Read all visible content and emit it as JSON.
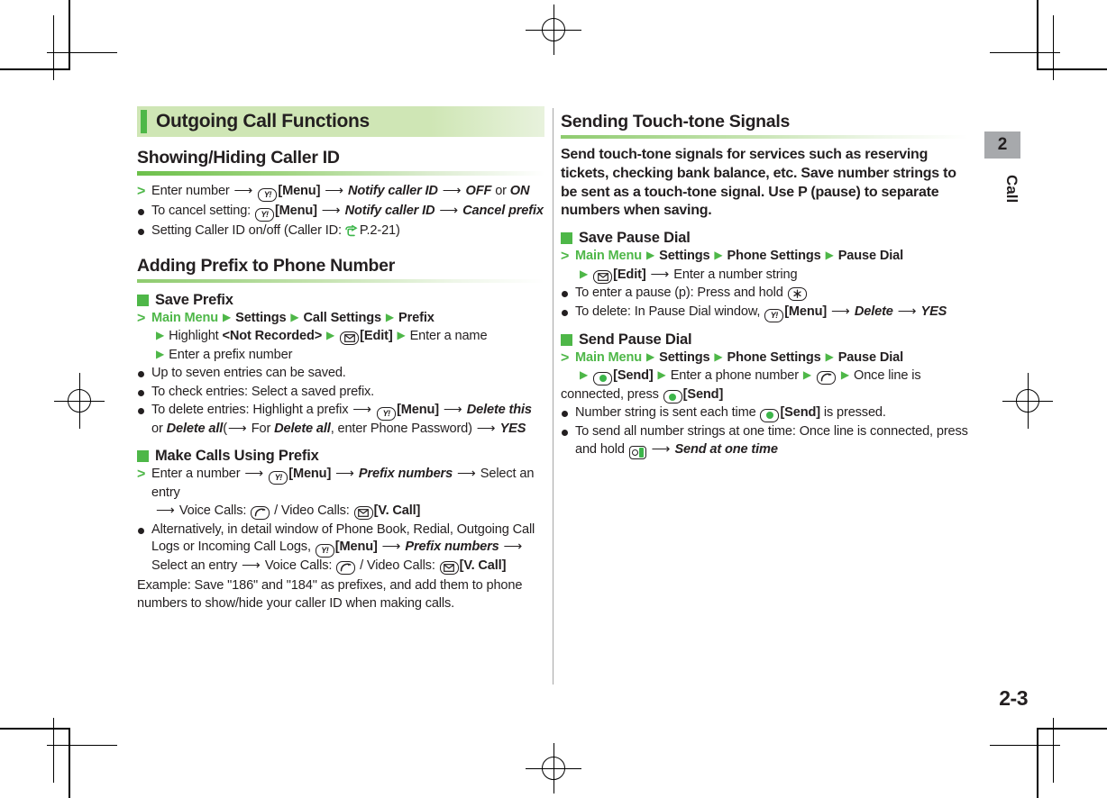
{
  "page": {
    "number": "2-3",
    "chapter_number": "2",
    "chapter_label": "Call"
  },
  "left_column": {
    "section_banner": "Outgoing Call Functions",
    "subsections": [
      {
        "title": "Showing/Hiding Caller ID",
        "lines": [
          "Enter number → [Y!][Menu] → Notify caller ID → OFF or ON",
          "To cancel setting: [Y!][Menu] → Notify caller ID → Cancel prefix",
          "Setting Caller ID on/off (Caller ID: ☞ P.2-21)"
        ]
      },
      {
        "title": "Adding Prefix to Phone Number",
        "groups": [
          {
            "heading": "Save Prefix",
            "lines": [
              "Main Menu ▶ Settings ▶ Call Settings ▶ Prefix",
              "▶ Highlight <Not Recorded> ▶ [Mail][Edit] ▶ Enter a name",
              "▶ Enter a prefix number",
              "Up to seven entries can be saved.",
              "To check entries: Select a saved prefix.",
              "To delete entries: Highlight a prefix → [Y!][Menu] → Delete this or Delete all (→ For Delete all, enter Phone Password) → YES"
            ]
          },
          {
            "heading": "Make Calls Using Prefix",
            "lines": [
              "Enter a number → [Y!][Menu] → Prefix numbers → Select an entry → Voice Calls: [Call] / Video Calls: [Mail][V. Call]",
              "Alternatively, in detail window of Phone Book, Redial, Outgoing Call Logs or Incoming Call Logs, [Y!][Menu] → Prefix numbers → Select an entry → Voice Calls: [Call] / Video Calls: [Mail][V. Call]"
            ]
          }
        ],
        "example": "Example: Save \"186\" and \"184\" as prefixes, and add them to phone numbers to show/hide your caller ID when making calls."
      }
    ],
    "text": {
      "caller_id_step_1a": "Enter number",
      "caller_id_step_1b": "[Menu]",
      "caller_id_step_1c": "Notify caller ID",
      "caller_id_step_1d": "OFF",
      "caller_id_step_1e": "or",
      "caller_id_step_1f": "ON",
      "caller_id_b1a": "To cancel setting:",
      "caller_id_b1b": "[Menu]",
      "caller_id_b1c": "Notify caller ID",
      "caller_id_b1d": "Cancel prefix",
      "caller_id_b2a": "Setting Caller ID on/off (Caller ID:",
      "caller_id_b2b": "P.2-21)",
      "save_prefix_heading": "Save Prefix",
      "sp_step_main": "Main Menu",
      "sp_step_settings": "Settings",
      "sp_step_call_settings": "Call Settings",
      "sp_step_prefix": "Prefix",
      "sp_l2_highlight": "Highlight",
      "sp_l2_notrec": "<Not Recorded>",
      "sp_l2_edit": "[Edit]",
      "sp_l2_entername": "Enter a name",
      "sp_l3": "Enter a prefix number",
      "sp_b1": "Up to seven entries can be saved.",
      "sp_b2": "To check entries: Select a saved prefix.",
      "sp_b3a": "To delete entries: Highlight a prefix",
      "sp_b3b": "[Menu]",
      "sp_b3c": "Delete this",
      "sp_b3d": "or",
      "sp_b3e": "Delete all",
      "sp_b3f": "For",
      "sp_b3g": "Delete all",
      "sp_b3h": ", enter Phone Password)",
      "sp_b3i": "YES",
      "mcup_heading": "Make Calls Using Prefix",
      "mcup_s1a": "Enter a number",
      "mcup_s1b": "[Menu]",
      "mcup_s1c": "Prefix numbers",
      "mcup_s1d": "Select an entry",
      "mcup_s2a": "Voice Calls:",
      "mcup_s2b": "/ Video Calls:",
      "mcup_s2c": "[V. Call]",
      "mcup_b1a": "Alternatively, in detail window of Phone Book, Redial, Outgoing Call Logs or Incoming Call Logs,",
      "mcup_b1b": "[Menu]",
      "mcup_b1c": "Prefix numbers",
      "mcup_b1d": "Select an",
      "mcup_b1e": "entry",
      "mcup_b1f": "Voice Calls:",
      "mcup_b1g": "/ Video Calls:",
      "mcup_b1h": "[V. Call]",
      "example_text": "Example: Save \"186\" and \"184\" as prefixes, and add them to phone numbers to show/hide your caller ID when making calls."
    }
  },
  "right_column": {
    "title": "Sending Touch-tone Signals",
    "lead": "Send touch-tone signals for services such as reserving tickets, checking bank balance, etc. Save number strings to be sent as a touch-tone signal. Use P (pause) to separate numbers when saving.",
    "text": {
      "save_pause_heading": "Save Pause Dial",
      "spd_main": "Main Menu",
      "spd_settings": "Settings",
      "spd_phone_settings": "Phone Settings",
      "spd_pause_dial": "Pause Dial",
      "spd_l2_edit": "[Edit]",
      "spd_l2_enter": "Enter a number string",
      "spd_b1": "To enter a pause (p): Press and hold",
      "spd_b2a": "To delete: In Pause Dial window,",
      "spd_b2b": "[Menu]",
      "spd_b2c": "Delete",
      "spd_b2d": "YES",
      "send_pause_heading": "Send Pause Dial",
      "send_main": "Main Menu",
      "send_settings": "Settings",
      "send_phone_settings": "Phone Settings",
      "send_pause_dial": "Pause Dial",
      "send_l2_send": "[Send]",
      "send_l2_enter": "Enter a phone number",
      "send_l2_once": "Once line is",
      "send_l3a": "connected, press",
      "send_l3b": "[Send]",
      "send_b1a": "Number string is sent each time",
      "send_b1b": "[Send]",
      "send_b1c": "is pressed.",
      "send_b2a": "To send all number strings at one time: Once line is connected, press and",
      "send_b2b": "hold",
      "send_b2c": "Send at one time"
    }
  },
  "icons": {
    "yk_label": "Y!",
    "mail_icon": "envelope-icon",
    "call_icon": "handset-icon",
    "send_icon": "center-send-icon",
    "star_icon": "star-key-icon",
    "side_icon": "side-key-icon",
    "ref_icon": "pointing-hand-icon"
  },
  "colors": {
    "accent_green": "#4eb748",
    "banner_green": "#cfe6b5",
    "chapter_gray": "#a7a9ac",
    "text": "#231f20"
  }
}
